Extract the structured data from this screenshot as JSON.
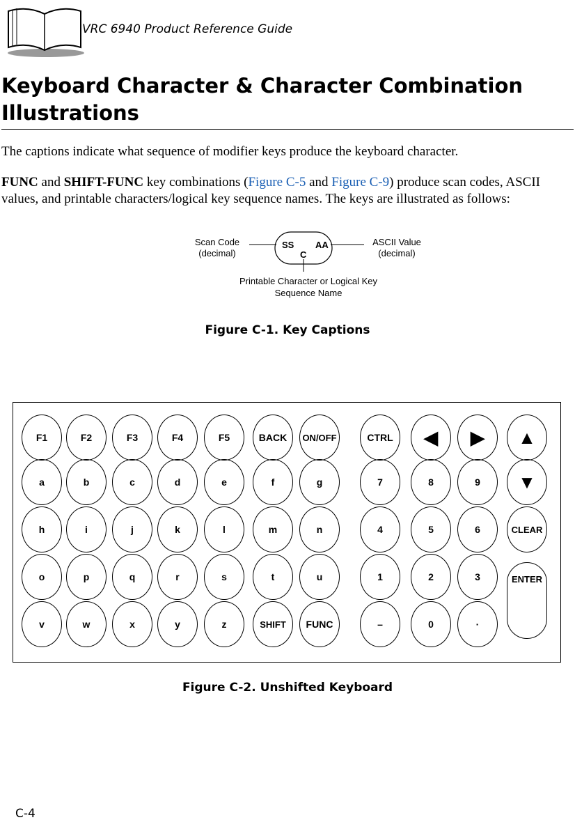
{
  "header": {
    "title": "VRC 6940 Product Reference Guide"
  },
  "section": {
    "title": "Keyboard Character & Character Combination Illustrations"
  },
  "body": {
    "p1": "The captions indicate what sequence of modifier keys produce the keyboard character.",
    "p2_a": "FUNC",
    "p2_b": " and ",
    "p2_c": "SHIFT-FUNC",
    "p2_d": " key combinations (",
    "p2_link1": "Figure C-5",
    "p2_e": " and ",
    "p2_link2": "Figure C-9",
    "p2_f": ") produce scan codes, ASCII values, and printable characters/logical key sequence names. The keys are illustrated as follows:"
  },
  "figure1": {
    "scan_code": "Scan Code",
    "scan_code_sub": "(decimal)",
    "ascii": "ASCII Value",
    "ascii_sub": "(decimal)",
    "ss": "SS",
    "aa": "AA",
    "c": "C",
    "printable": "Printable Character or Logical Key",
    "printable_sub": "Sequence Name",
    "caption": "Figure C-1.  Key Captions"
  },
  "figure2": {
    "caption": "Figure C-2.  Unshifted Keyboard",
    "keys": [
      [
        "F1",
        "F2",
        "F3",
        "F4",
        "F5",
        "BACK",
        "ON/OFF",
        "CTRL",
        "◀",
        "▶",
        "▲"
      ],
      [
        "a",
        "b",
        "c",
        "d",
        "e",
        "f",
        "g",
        "7",
        "8",
        "9",
        "▼"
      ],
      [
        "h",
        "i",
        "j",
        "k",
        "l",
        "m",
        "n",
        "4",
        "5",
        "6",
        "CLEAR"
      ],
      [
        "o",
        "p",
        "q",
        "r",
        "s",
        "t",
        "u",
        "1",
        "2",
        "3",
        "ENTER"
      ],
      [
        "v",
        "w",
        "x",
        "y",
        "z",
        "SHIFT",
        "FUNC",
        "–",
        "0",
        "·"
      ]
    ]
  },
  "footer": {
    "page": "C-4"
  }
}
